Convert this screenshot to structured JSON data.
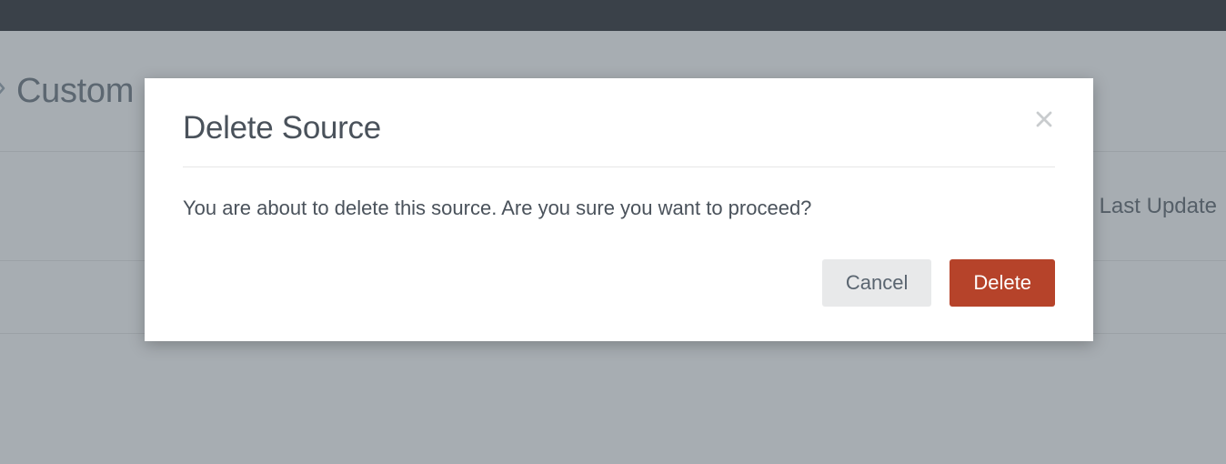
{
  "breadcrumb": {
    "label": "Custom"
  },
  "table": {
    "header_last_update": "Last Update"
  },
  "modal": {
    "title": "Delete Source",
    "message": "You are about to delete this source. Are you sure you want to proceed?",
    "cancel_label": "Cancel",
    "delete_label": "Delete"
  }
}
